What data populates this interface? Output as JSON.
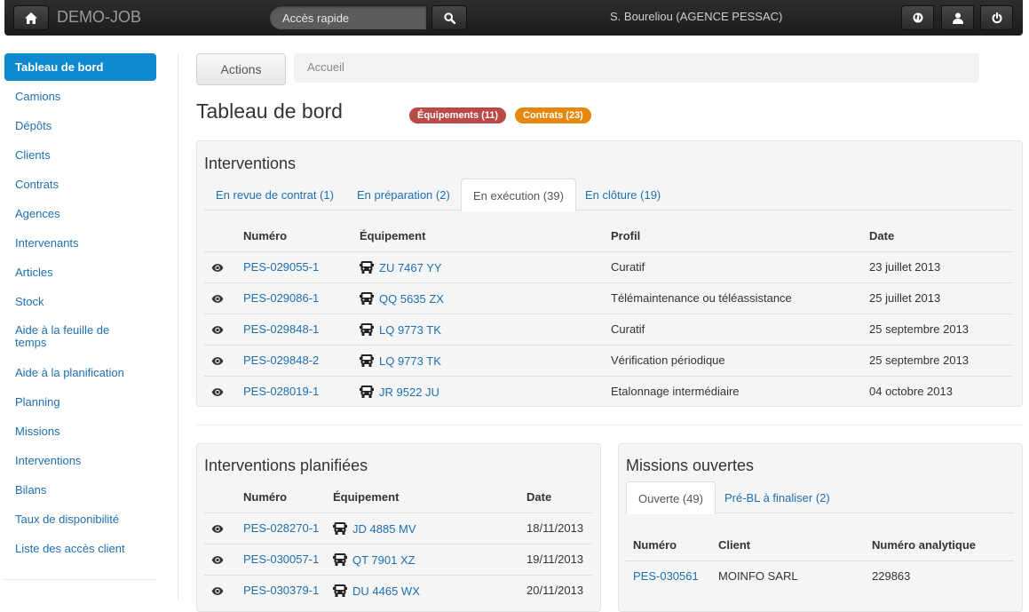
{
  "header": {
    "brand": "DEMO-JOB",
    "search_placeholder": "Accès rapide",
    "user": "S. Boureliou (AGENCE PESSAC)",
    "icons": [
      "home-icon",
      "search-icon",
      "globe-icon",
      "user-icon",
      "power-icon"
    ]
  },
  "sidebar": {
    "items": [
      {
        "label": "Tableau de bord",
        "active": true
      },
      {
        "label": "Camions"
      },
      {
        "label": "Dépôts"
      },
      {
        "label": "Clients"
      },
      {
        "label": "Contrats"
      },
      {
        "label": "Agences"
      },
      {
        "label": "Intervenants"
      },
      {
        "label": "Articles"
      },
      {
        "label": "Stock"
      },
      {
        "label_line1": "Aide à la feuille de",
        "label_line2": "temps"
      },
      {
        "label": "Aide à la planification"
      },
      {
        "label": "Planning"
      },
      {
        "label": "Missions"
      },
      {
        "label": "Interventions"
      },
      {
        "label": "Bilans"
      },
      {
        "label": "Taux de disponibilité"
      },
      {
        "label": "Liste des accès client"
      }
    ]
  },
  "toolbar": {
    "actions_label": "Actions",
    "breadcrumb": "Accueil"
  },
  "page": {
    "title": "Tableau de bord",
    "badge_equipements": "Équipements (11)",
    "badge_contrats": "Contrats (23)",
    "badge_colors": {
      "equipements": "#b94a48",
      "contrats": "#e4880f"
    }
  },
  "interventions": {
    "title": "Interventions",
    "tabs": [
      {
        "label": "En revue de contrat (1)"
      },
      {
        "label": "En préparation (2)"
      },
      {
        "label": "En exécution (39)",
        "active": true
      },
      {
        "label": "En clôture (19)"
      }
    ],
    "columns": [
      "Numéro",
      "Équipement",
      "Profil",
      "Date"
    ],
    "rows": [
      {
        "numero": "PES-029055-1",
        "equipement": "ZU 7467 YY",
        "profil": "Curatif",
        "date": "23 juillet 2013"
      },
      {
        "numero": "PES-029086-1",
        "equipement": "QQ 5635 ZX",
        "profil": "Télémaintenance ou téléassistance",
        "date": "25 juillet 2013"
      },
      {
        "numero": "PES-029848-1",
        "equipement": "LQ 9773 TK",
        "profil": "Curatif",
        "date": "25 septembre 2013"
      },
      {
        "numero": "PES-029848-2",
        "equipement": "LQ 9773 TK",
        "profil": "Vérification périodique",
        "date": "25 septembre 2013"
      },
      {
        "numero": "PES-028019-1",
        "equipement": "JR 9522 JU",
        "profil": "Etalonnage intermédiaire",
        "date": "04 octobre 2013"
      }
    ]
  },
  "planifiees": {
    "title": "Interventions planifiées",
    "columns": [
      "Numéro",
      "Équipement",
      "Date"
    ],
    "rows": [
      {
        "numero": "PES-028270-1",
        "equipement": "JD 4885 MV",
        "date": "18/11/2013"
      },
      {
        "numero": "PES-030057-1",
        "equipement": "QT 7901 XZ",
        "date": "19/11/2013"
      },
      {
        "numero": "PES-030379-1",
        "equipement": "DU 4465 WX",
        "date": "20/11/2013"
      }
    ]
  },
  "missions": {
    "title": "Missions ouvertes",
    "tabs": [
      {
        "label": "Ouverte (49)",
        "active": true
      },
      {
        "label": "Pré-BL à finaliser (2)"
      }
    ],
    "columns": [
      "Numéro",
      "Client",
      "Numéro analytique"
    ],
    "rows": [
      {
        "numero": "PES-030561",
        "client": "MOINFO SARL",
        "analytique": "229863"
      }
    ]
  }
}
